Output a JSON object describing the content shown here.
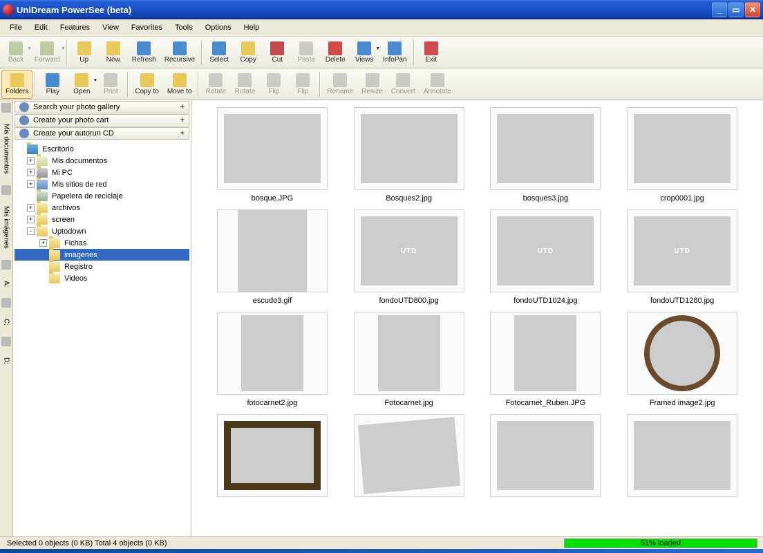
{
  "window": {
    "title": "UniDream PowerSee (beta)"
  },
  "menu": [
    "File",
    "Edit",
    "Features",
    "View",
    "Favorites",
    "Tools",
    "Options",
    "Help"
  ],
  "toolbar1": [
    {
      "name": "back",
      "label": "Back",
      "enabled": false,
      "hasDropdown": true
    },
    {
      "name": "forward",
      "label": "Forward",
      "enabled": false,
      "hasDropdown": true
    },
    {
      "sep": true
    },
    {
      "name": "up",
      "label": "Up",
      "enabled": true
    },
    {
      "name": "new",
      "label": "New",
      "enabled": true
    },
    {
      "name": "refresh",
      "label": "Refresh",
      "enabled": true
    },
    {
      "name": "recursive",
      "label": "Recursive",
      "enabled": true
    },
    {
      "sep": true
    },
    {
      "name": "select",
      "label": "Select",
      "enabled": true
    },
    {
      "name": "copy",
      "label": "Copy",
      "enabled": true
    },
    {
      "name": "cut",
      "label": "Cut",
      "enabled": true
    },
    {
      "name": "paste",
      "label": "Paste",
      "enabled": false
    },
    {
      "name": "delete",
      "label": "Delete",
      "enabled": true
    },
    {
      "name": "views",
      "label": "Views",
      "enabled": true,
      "hasDropdown": true
    },
    {
      "name": "infopan",
      "label": "InfoPan",
      "enabled": true
    },
    {
      "sep": true
    },
    {
      "name": "exit",
      "label": "Exit",
      "enabled": true
    }
  ],
  "toolbar2": [
    {
      "name": "folders",
      "label": "Folders",
      "enabled": true,
      "active": true
    },
    {
      "sep": true
    },
    {
      "name": "play",
      "label": "Play",
      "enabled": true
    },
    {
      "name": "open",
      "label": "Open",
      "enabled": true,
      "hasDropdown": true
    },
    {
      "name": "print",
      "label": "Print",
      "enabled": false
    },
    {
      "sep": true
    },
    {
      "name": "copyto",
      "label": "Copy to",
      "enabled": true
    },
    {
      "name": "moveto",
      "label": "Move to",
      "enabled": true
    },
    {
      "sep": true
    },
    {
      "name": "rotate-l",
      "label": "Rotate",
      "enabled": false
    },
    {
      "name": "rotate-r",
      "label": "Rotate",
      "enabled": false
    },
    {
      "name": "flip-h",
      "label": "Flip",
      "enabled": false
    },
    {
      "name": "flip-v",
      "label": "Flip",
      "enabled": false
    },
    {
      "sep": true
    },
    {
      "name": "rename",
      "label": "Rename",
      "enabled": false
    },
    {
      "name": "resize",
      "label": "Resize",
      "enabled": false
    },
    {
      "name": "convert",
      "label": "Convert",
      "enabled": false
    },
    {
      "name": "annotate",
      "label": "Annotate",
      "enabled": false
    }
  ],
  "leftTabs": [
    "Mis documentos",
    "Mis imágenes",
    "A:",
    "C:",
    "D:"
  ],
  "tasks": [
    {
      "label": "Search your photo gallery"
    },
    {
      "label": "Create your photo cart"
    },
    {
      "label": "Create your autorun CD"
    }
  ],
  "tree": [
    {
      "level": 0,
      "expand": null,
      "icon": "desktop",
      "label": "Escritorio"
    },
    {
      "level": 1,
      "expand": "+",
      "icon": "mydoc",
      "label": "Mis documentos"
    },
    {
      "level": 1,
      "expand": "+",
      "icon": "mypc",
      "label": "Mi PC"
    },
    {
      "level": 1,
      "expand": "+",
      "icon": "network",
      "label": "Mis sitios de red"
    },
    {
      "level": 1,
      "expand": null,
      "icon": "recycle",
      "label": "Papelera de reciclaje"
    },
    {
      "level": 1,
      "expand": "+",
      "icon": "folder",
      "label": "archivos"
    },
    {
      "level": 1,
      "expand": "+",
      "icon": "folder",
      "label": "screen"
    },
    {
      "level": 1,
      "expand": "-",
      "icon": "folder",
      "label": "Uptodown"
    },
    {
      "level": 2,
      "expand": "+",
      "icon": "folder",
      "label": "Fichas"
    },
    {
      "level": 2,
      "expand": null,
      "icon": "folder",
      "label": "imagenes",
      "selected": true
    },
    {
      "level": 2,
      "expand": null,
      "icon": "folder",
      "label": "Registro"
    },
    {
      "level": 2,
      "expand": null,
      "icon": "folder",
      "label": "Videos"
    }
  ],
  "thumbnails": [
    {
      "name": "bosque.JPG",
      "cls": "img-forest"
    },
    {
      "name": "Bosques2.jpg",
      "cls": "img-sunset"
    },
    {
      "name": "bosques3.jpg",
      "cls": "img-mountain"
    },
    {
      "name": "crop0001.jpg",
      "cls": "img-port"
    },
    {
      "name": "escudo3.gif",
      "cls": "img-shield"
    },
    {
      "name": "fondoUTD800.jpg",
      "cls": "img-utd",
      "text": "UTD"
    },
    {
      "name": "fondoUTD1024.jpg",
      "cls": "img-utd",
      "text": "UTD"
    },
    {
      "name": "fondoUTD1280.jpg",
      "cls": "img-utd",
      "text": "UTD"
    },
    {
      "name": "fotocarnet2.jpg",
      "cls": "img-face1"
    },
    {
      "name": "Fotocarnet.jpg",
      "cls": "img-face2"
    },
    {
      "name": "Fotocarnet_Ruben.JPG",
      "cls": "img-face3"
    },
    {
      "name": "Framed image2.jpg",
      "cls": "img-framed"
    },
    {
      "name": "",
      "cls": "img-painting"
    },
    {
      "name": "",
      "cls": "img-red"
    },
    {
      "name": "",
      "cls": "img-dragonfly"
    },
    {
      "name": "",
      "cls": "img-fantasy"
    }
  ],
  "status": {
    "text": "Selected 0 objects (0 KB) Total 4 objects (0 KB)",
    "progress": "51% loaded"
  }
}
